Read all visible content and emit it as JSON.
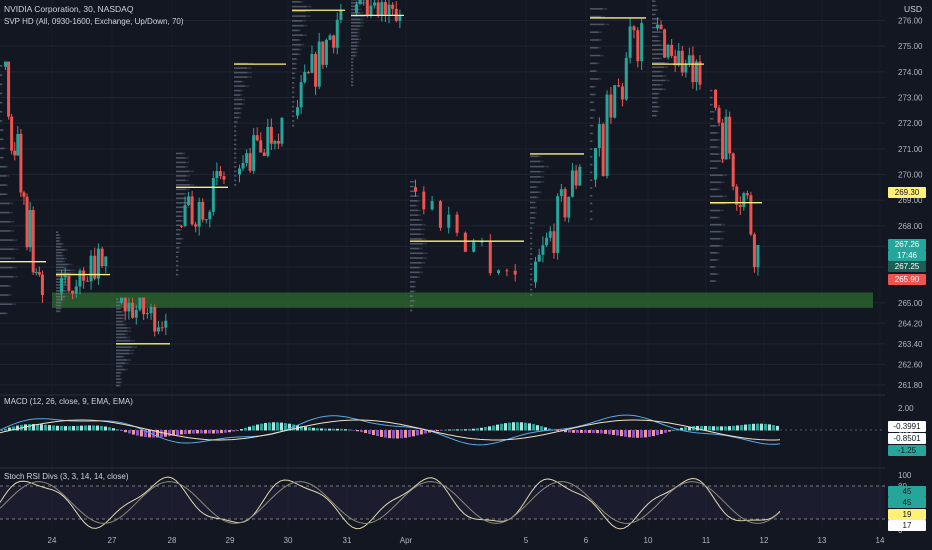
{
  "header": {
    "symbol_line": "NVIDIA Corporation, 30, NASDAQ",
    "indicator_line": "SVP HD (All, 0930-1600, Exchange, Up/Down, 70)",
    "currency": "USD"
  },
  "panels": {
    "macd_label": "MACD (12, 26, close, 9, EMA, EMA)",
    "stoch_label": "Stoch RSI Divs (3, 3, 14, 14, close)"
  },
  "badges": {
    "price_a": "269.30",
    "price_b": "267.26",
    "price_b_sub": "17:46",
    "price_c": "267.25",
    "price_d": "265.90",
    "macd_a": "-0.3991",
    "macd_b": "-0.8501",
    "macd_c": "-1.25",
    "stoch_a": "45",
    "stoch_b": "45",
    "stoch_c": "19",
    "stoch_d": "17"
  },
  "colors": {
    "background": "#131722",
    "up": "#26a69a",
    "down": "#ef5350",
    "poc": "#fff176",
    "zone": "#2e6b2f",
    "macd_line": "#5aa9e6",
    "signal_line": "#f0e0c0"
  },
  "chart_data": {
    "type": "candlestick",
    "y_axis": {
      "unit": "USD",
      "ticks": [
        276.0,
        275.0,
        274.0,
        273.0,
        272.0,
        271.0,
        270.0,
        269.0,
        268.0,
        267.2,
        266.4,
        265.0,
        264.2,
        263.4,
        262.6,
        261.8
      ],
      "range": [
        261.6,
        276.8
      ]
    },
    "x_axis": {
      "ticks": [
        "24",
        "27",
        "28",
        "29",
        "30",
        "31",
        "Apr",
        "5",
        "6",
        "10",
        "11",
        "12",
        "13",
        "14"
      ]
    },
    "sessions": [
      {
        "label": "24",
        "open": 274.2,
        "high": 274.4,
        "low": 264.4,
        "close": 265.3,
        "poc": 266.6
      },
      {
        "label": "27",
        "open": 265.4,
        "high": 267.8,
        "low": 264.6,
        "close": 266.8,
        "poc": 266.1
      },
      {
        "label": "28",
        "open": 265.0,
        "high": 265.2,
        "low": 261.7,
        "close": 264.3,
        "poc": 263.4
      },
      {
        "label": "29",
        "open": 268.0,
        "high": 270.9,
        "low": 266.0,
        "close": 269.8,
        "poc": 269.5
      },
      {
        "label": "30",
        "open": 270.0,
        "high": 274.4,
        "low": 269.5,
        "close": 272.2,
        "poc": 274.3
      },
      {
        "label": "31",
        "open": 272.3,
        "high": 277.0,
        "low": 271.8,
        "close": 276.4,
        "poc": 276.4
      },
      {
        "label": "Apr",
        "open": 276.3,
        "high": 277.0,
        "low": 273.4,
        "close": 276.2,
        "poc": 276.2
      },
      {
        "label": "5",
        "open": 269.5,
        "high": 269.8,
        "low": 264.6,
        "close": 266.1,
        "poc": 267.4
      },
      {
        "label": "6",
        "open": 265.8,
        "high": 270.8,
        "low": 265.2,
        "close": 270.3,
        "poc": 270.8
      },
      {
        "label": "10",
        "open": 269.8,
        "high": 276.6,
        "low": 268.1,
        "close": 275.9,
        "poc": 276.1
      },
      {
        "label": "11",
        "open": 275.7,
        "high": 277.0,
        "low": 272.2,
        "close": 273.5,
        "poc": 274.3
      },
      {
        "label": "12",
        "open": 273.3,
        "high": 273.4,
        "low": 265.7,
        "close": 267.25,
        "poc": 268.9
      }
    ],
    "zone": {
      "low": 264.8,
      "high": 265.4
    },
    "macd": {
      "ticks": [
        "2.00",
        "0.00",
        "-2.00"
      ],
      "current": [
        -0.3991,
        -0.8501,
        -1.25
      ]
    },
    "stoch_rsi": {
      "ticks": [
        "100",
        "80",
        "20",
        "0"
      ],
      "current": [
        45,
        45,
        19,
        17
      ]
    }
  }
}
